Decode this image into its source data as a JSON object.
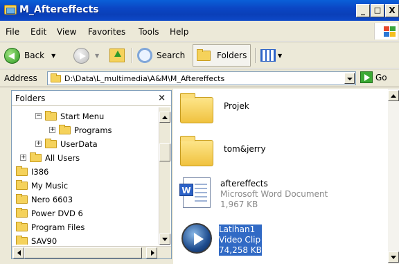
{
  "window": {
    "title": "M_Aftereffects",
    "controls": [
      "_",
      "□",
      "X"
    ]
  },
  "menu": [
    "File",
    "Edit",
    "View",
    "Favorites",
    "Tools",
    "Help"
  ],
  "toolbar": {
    "back": "Back",
    "search": "Search",
    "folders": "Folders"
  },
  "address": {
    "label": "Address",
    "path": "D:\\Data\\L_multimedia\\A&M\\M_Aftereffects",
    "go": "Go"
  },
  "folders_pane": {
    "title": "Folders",
    "close": "×",
    "tree": [
      {
        "label": "Start Menu",
        "expander": "⊟"
      },
      {
        "label": "Programs",
        "expander": "⊞"
      },
      {
        "label": "UserData",
        "expander": "⊞"
      },
      {
        "label": "All Users",
        "expander": "⊞"
      },
      {
        "label": "I386",
        "expander": ""
      },
      {
        "label": "My Music",
        "expander": ""
      },
      {
        "label": "Nero 6603",
        "expander": ""
      },
      {
        "label": "Power DVD 6",
        "expander": ""
      },
      {
        "label": "Program Files",
        "expander": ""
      },
      {
        "label": "SAV90",
        "expander": ""
      }
    ]
  },
  "files": [
    {
      "name": "Projek",
      "icon": "folder-icon"
    },
    {
      "name": "tom&jerry",
      "icon": "folder-icon"
    },
    {
      "name": "aftereffects",
      "type": "Microsoft Word Document",
      "size": "1,967 KB",
      "icon": "word-document-icon"
    },
    {
      "name": "Latihan1",
      "type": "Video Clip",
      "size": "74,258 KB",
      "icon": "media-player-icon",
      "selected": true
    }
  ]
}
